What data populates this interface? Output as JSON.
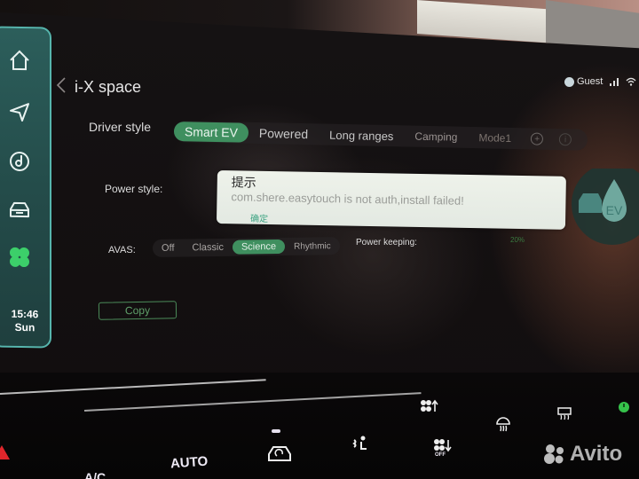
{
  "app": {
    "title": "i-X space",
    "status_bar": {
      "user": "Guest",
      "icons": [
        "avatar-icon",
        "signal-icon",
        "wifi-icon",
        "bluetooth-icon"
      ]
    }
  },
  "sidebar": {
    "items": [
      {
        "name": "home",
        "icon": "home-icon"
      },
      {
        "name": "navigation",
        "icon": "navigation-arrow-icon"
      },
      {
        "name": "music",
        "icon": "music-disc-icon"
      },
      {
        "name": "vehicle",
        "icon": "car-icon"
      },
      {
        "name": "apps",
        "icon": "clover-icon",
        "active": true
      }
    ],
    "time": "15:46",
    "day": "Sun"
  },
  "driver_style": {
    "label": "Driver style",
    "tabs": [
      {
        "label": "Smart EV",
        "active": true
      },
      {
        "label": "Powered",
        "active": false
      },
      {
        "label": "Long ranges",
        "active": false
      },
      {
        "label": "Camping",
        "active": false
      },
      {
        "label": "Mode1",
        "active": false
      }
    ],
    "add_icon": "plus-circle-icon",
    "info_icon": "info-circle-icon"
  },
  "power_style": {
    "label": "Power style:"
  },
  "dialog": {
    "title": "提示",
    "message": "com.shere.easytouch is not auth,install failed!",
    "ok_label": "确定"
  },
  "avas": {
    "label": "AVAS:",
    "options": [
      {
        "label": "Off",
        "active": false
      },
      {
        "label": "Classic",
        "active": false
      },
      {
        "label": "Science",
        "active": true
      },
      {
        "label": "Rhythmic",
        "active": false
      }
    ]
  },
  "power_keeping": {
    "label": "Power keeping:",
    "value": "20%"
  },
  "ev_badge": {
    "text": "EV"
  },
  "copy_button": {
    "label": "Copy"
  },
  "climate_panel": {
    "ac_label": "A/C",
    "auto_label": "AUTO",
    "fan_off_label": "OFF",
    "icons": [
      "hazard-icon",
      "recirculation-icon",
      "seat-heat-icon",
      "fan-up-icon",
      "fan-down-icon",
      "front-defrost-icon",
      "rear-defrost-icon",
      "power-icon"
    ]
  },
  "watermark": {
    "text": "Avito"
  },
  "colors": {
    "accent": "#3f8f5f",
    "sidebar": "#2c5e5b",
    "sidebar_border": "#56b5ad",
    "dialog_ok": "#3ea483"
  }
}
